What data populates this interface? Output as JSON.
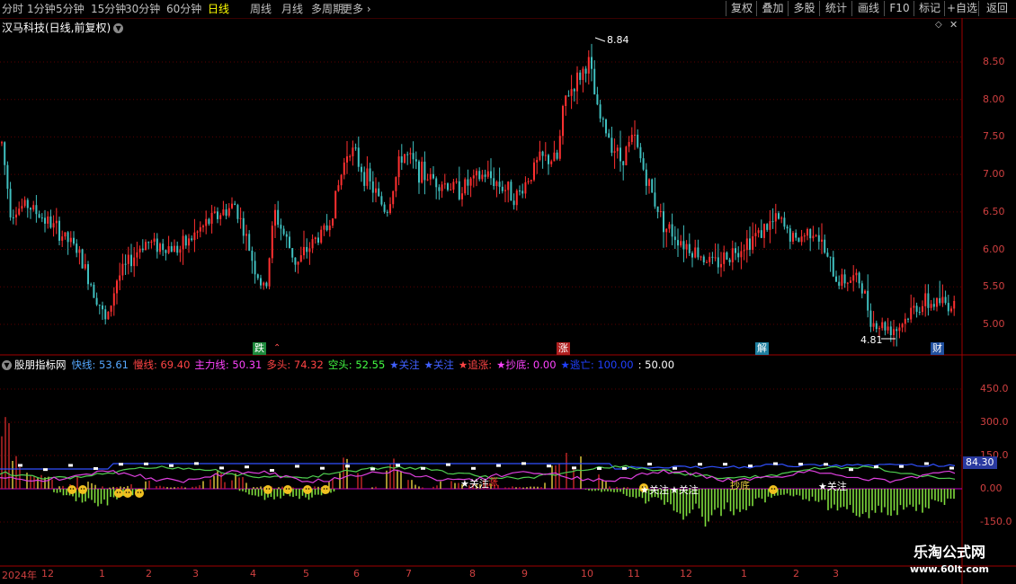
{
  "toolbar": {
    "timeframes": [
      {
        "label": "分时"
      },
      {
        "label": "1分钟"
      },
      {
        "label": "5分钟"
      },
      {
        "label": "15分钟"
      },
      {
        "label": "30分钟"
      },
      {
        "label": "60分钟"
      },
      {
        "label": "日线",
        "active": true
      },
      {
        "label": "周线"
      },
      {
        "label": "月线"
      },
      {
        "label": "多周期"
      },
      {
        "label": "更多"
      }
    ],
    "right_buttons": [
      {
        "label": "复权"
      },
      {
        "label": "叠加"
      },
      {
        "label": "多股"
      },
      {
        "label": "统计"
      },
      {
        "label": "画线"
      },
      {
        "label": "F10"
      },
      {
        "label": "标记"
      },
      {
        "label": "+自选"
      },
      {
        "label": "返回"
      }
    ]
  },
  "main_chart": {
    "title": "汉马科技(日线,前复权)",
    "y_ticks": [
      "8.50",
      "8.00",
      "7.50",
      "7.00",
      "6.50",
      "6.00",
      "5.50",
      "5.00"
    ],
    "high_label": "8.84",
    "low_label": "4.81",
    "markers": [
      {
        "text": "跌",
        "color": "#ffffff",
        "bg": "#1e8a3c"
      },
      {
        "text": "涨",
        "color": "#ffffff",
        "bg": "#b02020"
      },
      {
        "text": "解",
        "color": "#ffffff",
        "bg": "#1e7fa0"
      },
      {
        "text": "财",
        "color": "#ffffff",
        "bg": "#2050a0"
      }
    ]
  },
  "indicator": {
    "name": "股朋指标网",
    "items": [
      {
        "label": "快线:",
        "value": "53.61",
        "color": "#55a8ff"
      },
      {
        "label": "慢线:",
        "value": "69.40",
        "color": "#ff4444"
      },
      {
        "label": "主力线:",
        "value": "50.31",
        "color": "#ff44ff"
      },
      {
        "label": "多头:",
        "value": "74.32",
        "color": "#ff4444"
      },
      {
        "label": "空头:",
        "value": "52.55",
        "color": "#44ff44"
      },
      {
        "label": "★关注",
        "value": "",
        "color": "#4060ff"
      },
      {
        "label": "★关注",
        "value": "",
        "color": "#4060ff"
      },
      {
        "label": "★追涨:",
        "value": "",
        "color": "#ff4444"
      },
      {
        "label": "★抄底:",
        "value": "0.00",
        "color": "#ff44ff"
      },
      {
        "label": "★逃亡:",
        "value": "100.00",
        "color": "#2040ff"
      },
      {
        "label": ":",
        "value": "50.00",
        "color": "#ffffff"
      }
    ],
    "y_ticks": [
      "450.0",
      "300.0",
      "150.0",
      "0.00",
      "-150.0"
    ],
    "current_value": "84.30",
    "annotations": [
      "★关注",
      "★关注",
      "涨",
      "★关注",
      "★关注",
      "抄底"
    ]
  },
  "dates": [
    {
      "label": "2024年",
      "x": 2
    },
    {
      "label": "12",
      "x": 46
    },
    {
      "label": "1",
      "x": 110
    },
    {
      "label": "2",
      "x": 162
    },
    {
      "label": "3",
      "x": 214
    },
    {
      "label": "4",
      "x": 278
    },
    {
      "label": "5",
      "x": 337
    },
    {
      "label": "6",
      "x": 393
    },
    {
      "label": "7",
      "x": 451
    },
    {
      "label": "8",
      "x": 522
    },
    {
      "label": "9",
      "x": 580
    },
    {
      "label": "10",
      "x": 646
    },
    {
      "label": "11",
      "x": 698
    },
    {
      "label": "12",
      "x": 756
    },
    {
      "label": "1",
      "x": 824
    },
    {
      "label": "2",
      "x": 882
    },
    {
      "label": "3",
      "x": 926
    }
  ],
  "watermark": {
    "line1": "乐淘公式网",
    "line2": "www.60lt.com"
  },
  "colors": {
    "up": "#ff3030",
    "down": "#40c0c0",
    "grid": "#5a0000",
    "axis": "#a00000"
  }
}
